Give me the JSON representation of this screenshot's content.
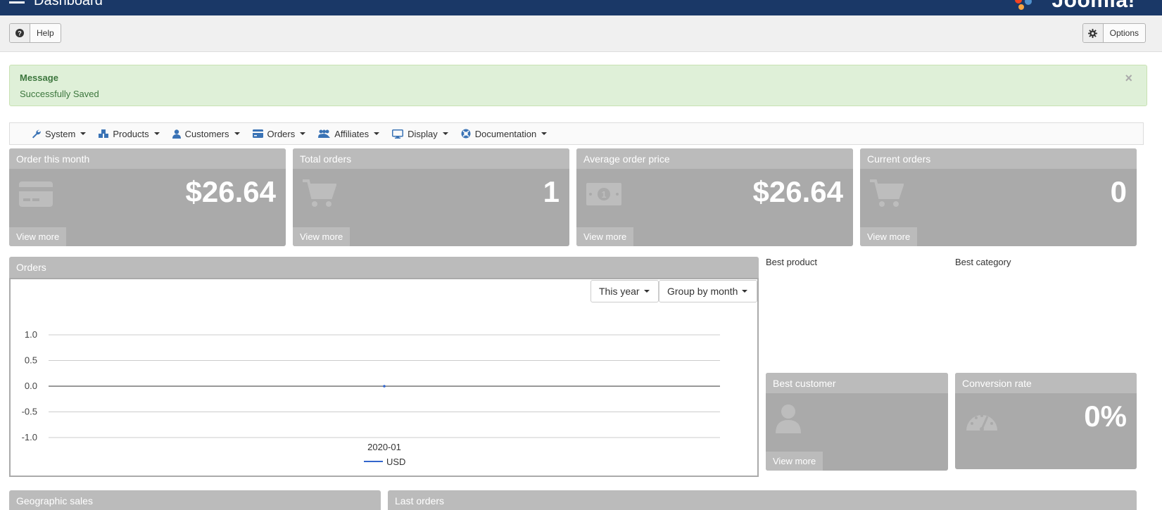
{
  "header": {
    "title": "Dashboard",
    "logo": "Joomla!"
  },
  "toolbar": {
    "help_label": "Help",
    "options_label": "Options"
  },
  "alert": {
    "heading": "Message",
    "text": "Successfully Saved",
    "close": "×"
  },
  "menu": {
    "items": [
      {
        "label": "System",
        "icon": "wrench-icon"
      },
      {
        "label": "Products",
        "icon": "cubes-icon"
      },
      {
        "label": "Customers",
        "icon": "user-icon"
      },
      {
        "label": "Orders",
        "icon": "credit-card-icon"
      },
      {
        "label": "Affiliates",
        "icon": "users-icon"
      },
      {
        "label": "Display",
        "icon": "desktop-icon"
      },
      {
        "label": "Documentation",
        "icon": "life-ring-icon"
      }
    ]
  },
  "stats": [
    {
      "title": "Order this month",
      "value": "$26.64",
      "icon": "credit-card-icon",
      "link": "View more"
    },
    {
      "title": "Total orders",
      "value": "1",
      "icon": "shopping-cart-icon",
      "link": "View more"
    },
    {
      "title": "Average order price",
      "value": "$26.64",
      "icon": "money-icon",
      "link": "View more"
    },
    {
      "title": "Current orders",
      "value": "0",
      "icon": "shopping-cart-icon",
      "link": "View more"
    }
  ],
  "orders": {
    "title": "Orders",
    "period_select": "This year",
    "group_select": "Group by month"
  },
  "chart_data": {
    "type": "line",
    "x": [
      "2020-01"
    ],
    "series": [
      {
        "name": "USD",
        "values": [
          0
        ],
        "color": "#3366cc"
      }
    ],
    "yticks": [
      "1.0",
      "0.5",
      "0.0",
      "-0.5",
      "-1.0"
    ],
    "ylim": [
      -1,
      1
    ],
    "legend": "bottom"
  },
  "side": {
    "best_product": "Best product",
    "best_category": "Best category",
    "best_customer": {
      "title": "Best customer",
      "link": "View more"
    },
    "conversion": {
      "title": "Conversion rate",
      "value": "0%"
    }
  },
  "bottom": {
    "geo": "Geographic sales",
    "last_orders": "Last orders"
  }
}
